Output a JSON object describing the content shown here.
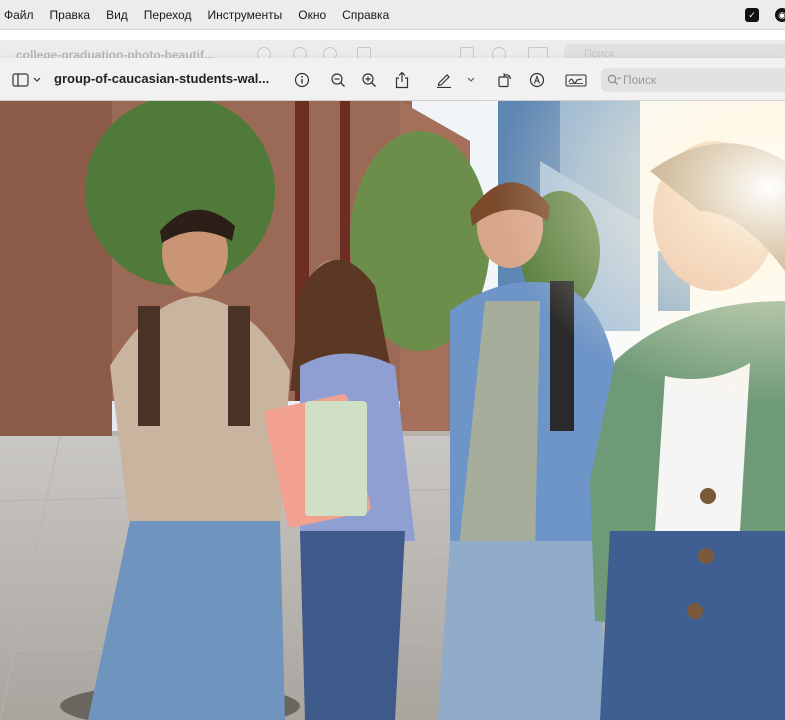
{
  "menubar": {
    "items": [
      "Файл",
      "Правка",
      "Вид",
      "Переход",
      "Инструменты",
      "Окно",
      "Справка"
    ]
  },
  "background_window": {
    "title": "college-graduation-photo-beautif...",
    "search_placeholder": "Поиск"
  },
  "toolbar": {
    "title": "group-of-caucasian-students-wal...",
    "search_placeholder": "Поиск",
    "icons": [
      "sidebar-icon",
      "chevron-down-icon",
      "info-icon",
      "zoom-out-icon",
      "zoom-in-icon",
      "share-icon",
      "markup-pen-icon",
      "chevron-down-icon",
      "rotate-icon",
      "annotate-icon",
      "signature-icon",
      "search-icon"
    ]
  },
  "image": {
    "description_icon": "photo"
  }
}
